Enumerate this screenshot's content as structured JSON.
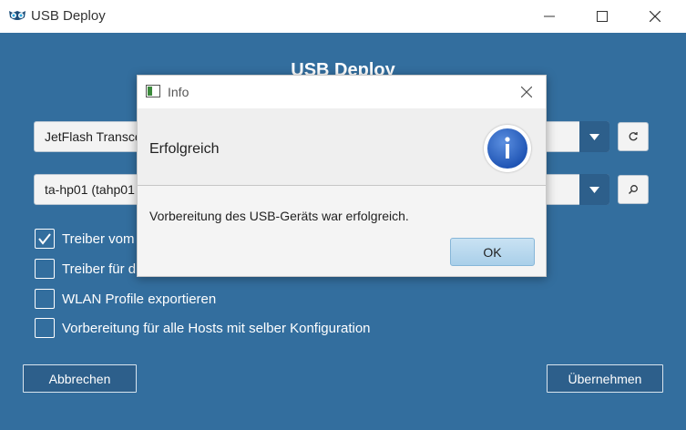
{
  "window": {
    "title": "USB Deploy",
    "logo_icon": "owl-logo-icon",
    "minimize_icon": "minimize-icon",
    "maximize_icon": "maximize-icon",
    "close_icon": "close-icon"
  },
  "main": {
    "heading": "USB Deploy",
    "usb_device_select": {
      "value": "JetFlash Transce",
      "refresh_icon": "refresh-icon"
    },
    "host_select": {
      "value": "ta-hp01 (tahp01",
      "search_icon": "search-icon"
    },
    "options": [
      {
        "label": "Treiber vom",
        "checked": true
      },
      {
        "label": "Treiber für d",
        "checked": false
      },
      {
        "label": "WLAN Profile exportieren",
        "checked": false
      },
      {
        "label": "Vorbereitung für alle Hosts mit selber Konfiguration",
        "checked": false
      }
    ],
    "cancel_label": "Abbrechen",
    "apply_label": "Übernehmen"
  },
  "dialog": {
    "title": "Info",
    "header": "Erfolgreich",
    "icon": "info-icon",
    "message": "Vorbereitung des USB-Geräts war erfolgreich.",
    "ok_label": "OK"
  },
  "colors": {
    "background": "#336e9e",
    "accent_dark": "#2d5f8b",
    "ok_button": "#b8d9ef"
  }
}
